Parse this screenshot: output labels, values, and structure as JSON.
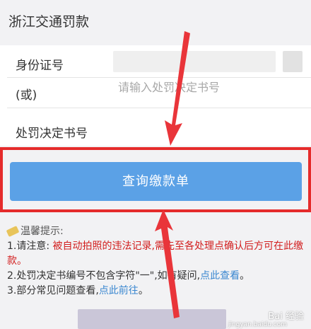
{
  "page": {
    "title": "浙江交通罚款"
  },
  "form": {
    "id_label": "身份证号",
    "or_label": "(或)",
    "decision_label": "处罚决定书号",
    "decision_placeholder": "请输入处罚决定书号"
  },
  "actions": {
    "query_label": "查询缴款单"
  },
  "tips": {
    "title": "温馨提示:",
    "line1_prefix": "1.请注意: ",
    "line1_red": "被自动拍照的违法记录,需先至各处理点确认后方可在此缴款。",
    "line2_prefix": "2.处罚决定书编号不包含字符\"一\",如有疑问,",
    "line2_link": "点此查看",
    "line2_suffix": "。",
    "line3_prefix": "3.部分常见问题查看,",
    "line3_link": "点此前往",
    "line3_suffix": "。"
  },
  "watermark": {
    "brand": "Bai 经验",
    "sub": "jingyan.baidu.com"
  },
  "colors": {
    "button": "#5ba1e6",
    "highlight": "#e52b2b",
    "warning": "#d21e1e",
    "link": "#3a87d0"
  }
}
